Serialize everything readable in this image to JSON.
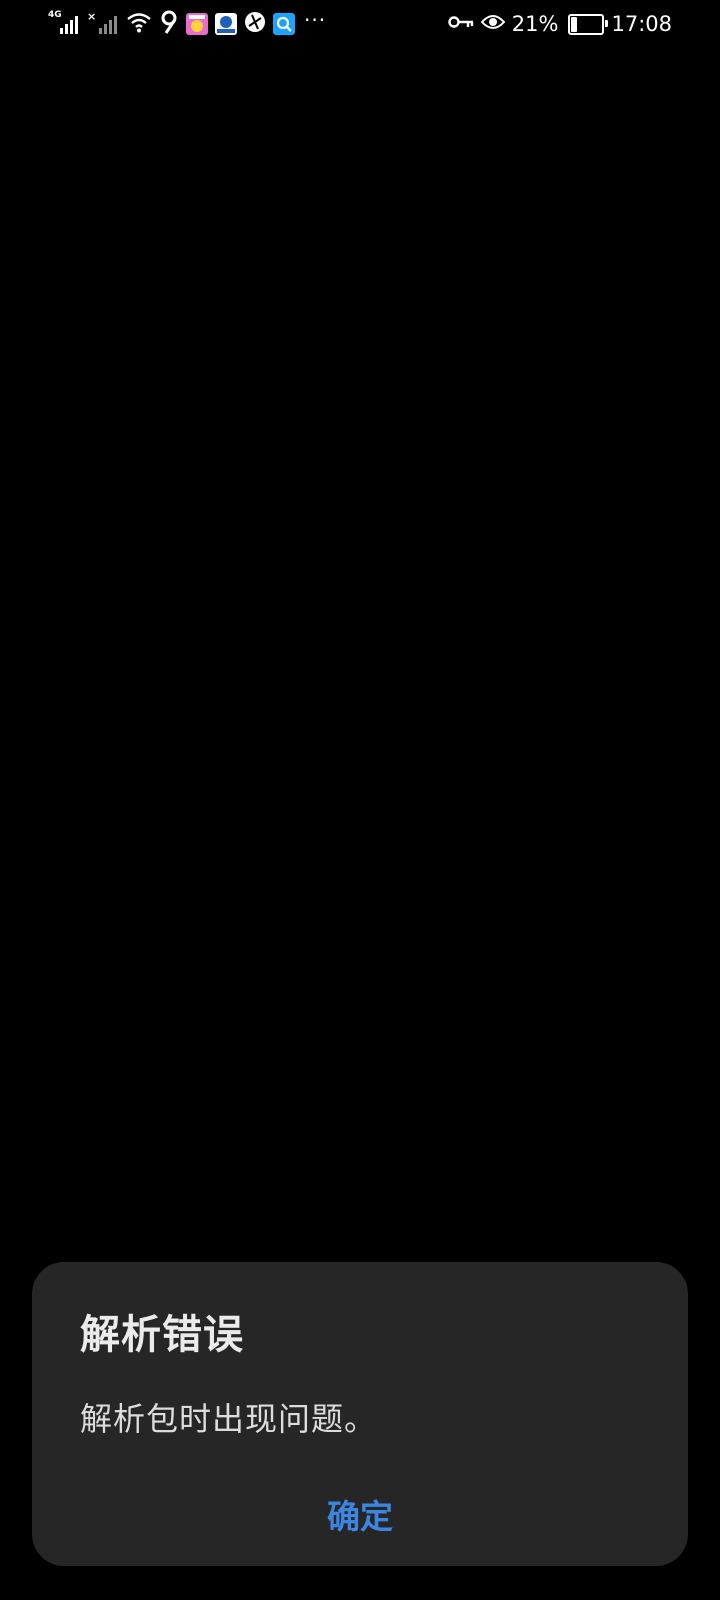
{
  "status_bar": {
    "network_type": "4G",
    "no_signal_mark": "×",
    "more_dots": "···",
    "battery_percent": "21%",
    "battery_level": 0.21,
    "time": "17:08",
    "icons": [
      "signal-4g-icon",
      "signal-no-sim-icon",
      "wifi-icon",
      "app-notification-icon",
      "key-icon",
      "eye-icon",
      "battery-icon"
    ]
  },
  "dialog": {
    "title": "解析错误",
    "message": "解析包时出现问题。",
    "confirm_label": "确定",
    "accent_color": "#3a86e0",
    "background": "#262626"
  }
}
